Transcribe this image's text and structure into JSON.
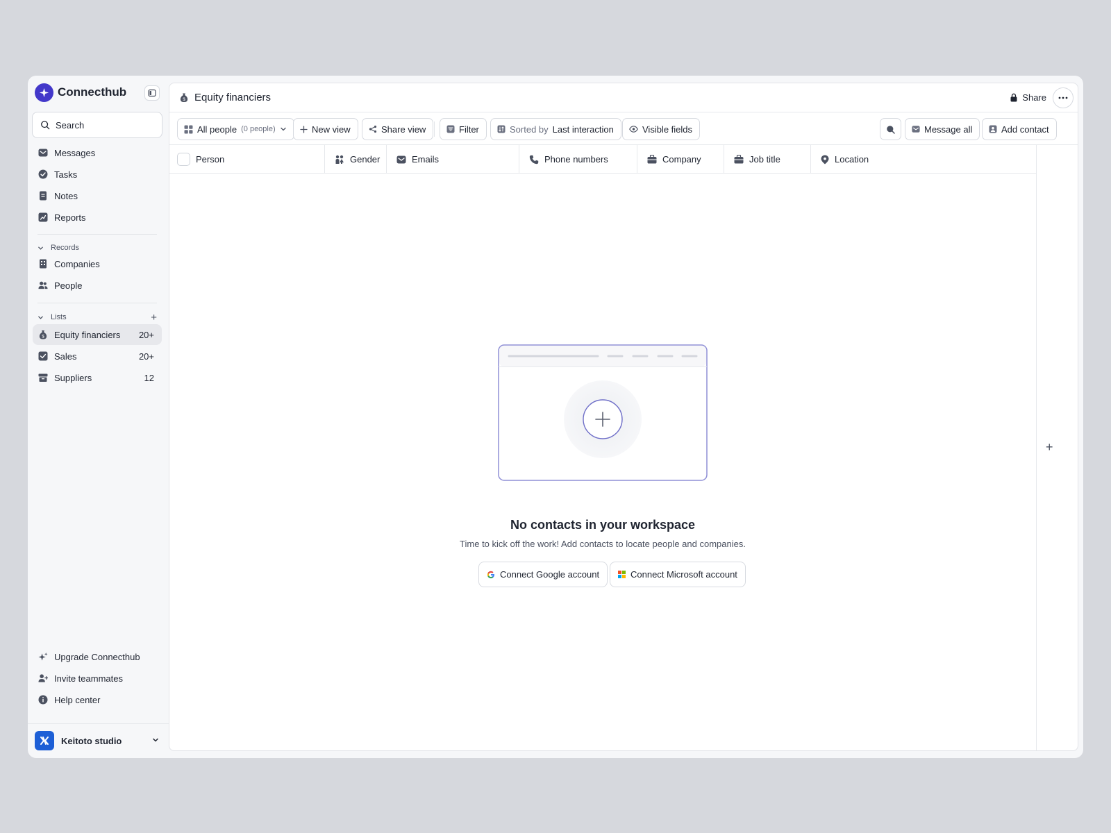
{
  "app": {
    "name": "Connecthub"
  },
  "search": {
    "label": "Search"
  },
  "nav": {
    "main": [
      {
        "label": "Messages",
        "icon": "mail-icon"
      },
      {
        "label": "Tasks",
        "icon": "check-circle-icon"
      },
      {
        "label": "Notes",
        "icon": "note-icon"
      },
      {
        "label": "Reports",
        "icon": "chart-icon"
      }
    ],
    "records_label": "Records",
    "records": [
      {
        "label": "Companies",
        "icon": "building-icon"
      },
      {
        "label": "People",
        "icon": "people-icon"
      }
    ],
    "lists_label": "Lists",
    "lists": [
      {
        "label": "Equity financiers",
        "count": "20+",
        "icon": "money-bag-icon",
        "active": true
      },
      {
        "label": "Sales",
        "count": "20+",
        "icon": "sales-icon"
      },
      {
        "label": "Suppliers",
        "count": "12",
        "icon": "box-icon"
      }
    ],
    "footer": [
      {
        "label": "Upgrade Connecthub",
        "icon": "sparkle-icon"
      },
      {
        "label": "Invite teammates",
        "icon": "user-plus-icon"
      },
      {
        "label": "Help center",
        "icon": "info-icon"
      }
    ]
  },
  "workspace": {
    "name": "Keitoto studio"
  },
  "header": {
    "title": "Equity financiers",
    "share_label": "Share"
  },
  "toolbar": {
    "view_label": "All people",
    "view_count": "(0 people)",
    "new_view": "New view",
    "share_view": "Share view",
    "filter": "Filter",
    "sorted_by": "Sorted by",
    "sort_field": "Last interaction",
    "visible_fields": "Visible fields",
    "message_all": "Message all",
    "add_contact": "Add contact"
  },
  "columns": [
    "Person",
    "Gender",
    "Emails",
    "Phone numbers",
    "Company",
    "Job title",
    "Location"
  ],
  "empty_state": {
    "title": "No contacts in your workspace",
    "subtitle": "Time to kick off the work! Add contacts to locate people and companies.",
    "google_button": "Connect Google account",
    "microsoft_button": "Connect Microsoft account"
  },
  "colors": {
    "brand": "#4338ca",
    "workspace": "#1d5fd6",
    "accent_outline": "#8f8fd6"
  }
}
